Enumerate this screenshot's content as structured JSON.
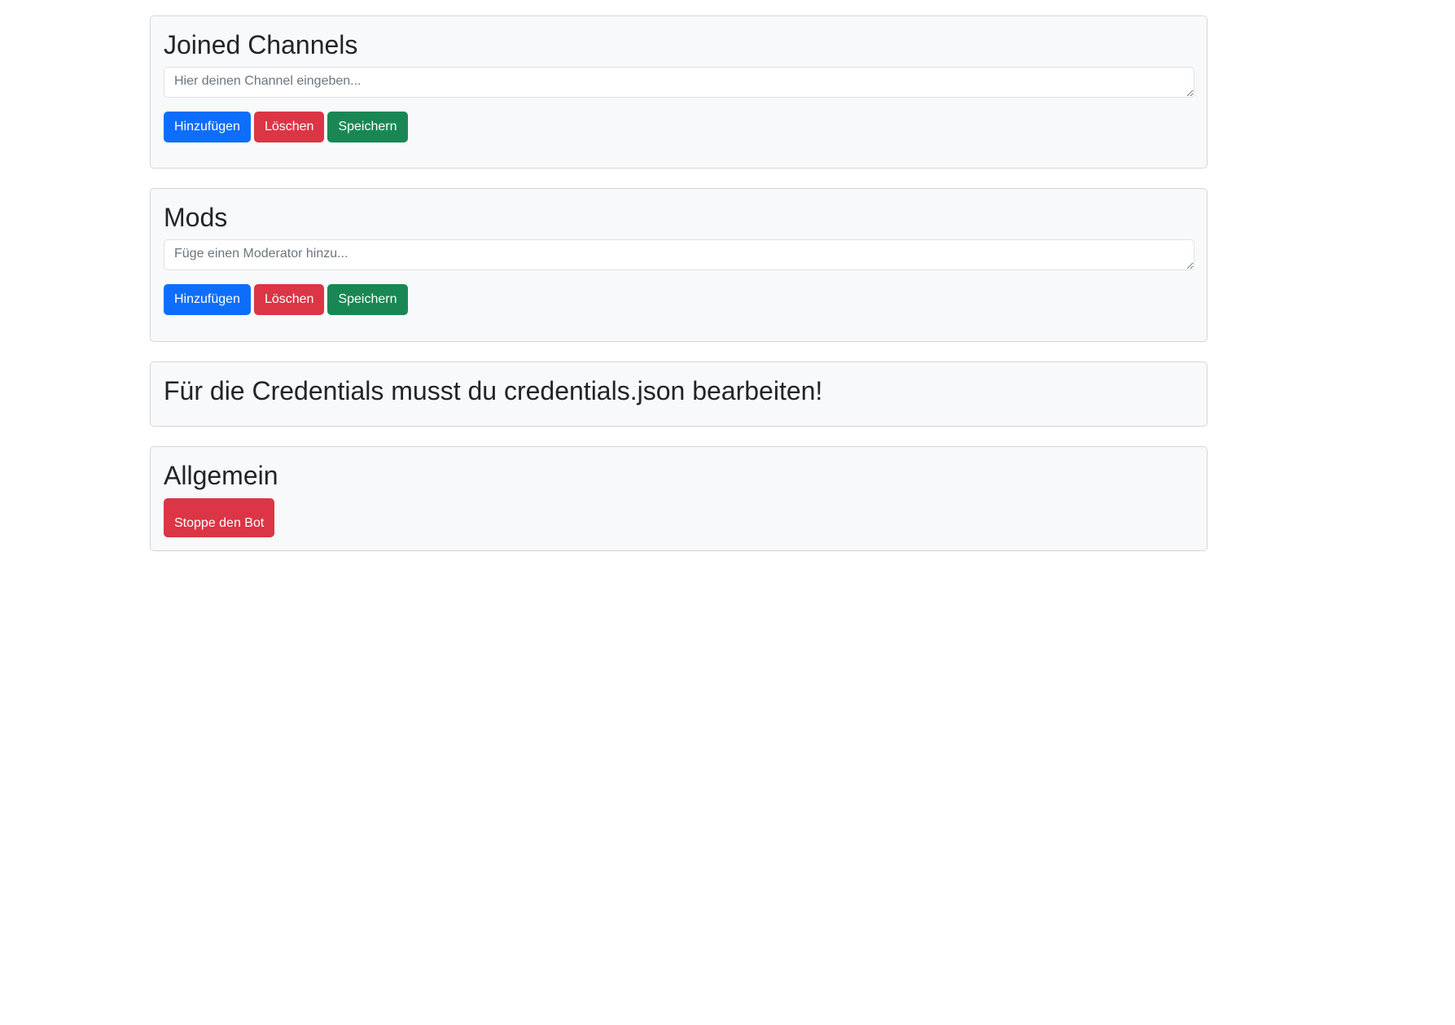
{
  "channels": {
    "title": "Joined Channels",
    "input_placeholder": "Hier deinen Channel eingeben...",
    "add_label": "Hinzufügen",
    "delete_label": "Löschen",
    "save_label": "Speichern"
  },
  "mods": {
    "title": "Mods",
    "input_placeholder": "Füge einen Moderator hinzu...",
    "add_label": "Hinzufügen",
    "delete_label": "Löschen",
    "save_label": "Speichern"
  },
  "credentials": {
    "notice": "Für die Credentials musst du credentials.json bearbeiten!"
  },
  "general": {
    "title": "Allgemein",
    "stop_label": "Stoppe den Bot"
  },
  "colors": {
    "primary": "#0d6efd",
    "danger": "#dc3545",
    "success": "#198754",
    "card_bg": "#f8f9fa"
  }
}
